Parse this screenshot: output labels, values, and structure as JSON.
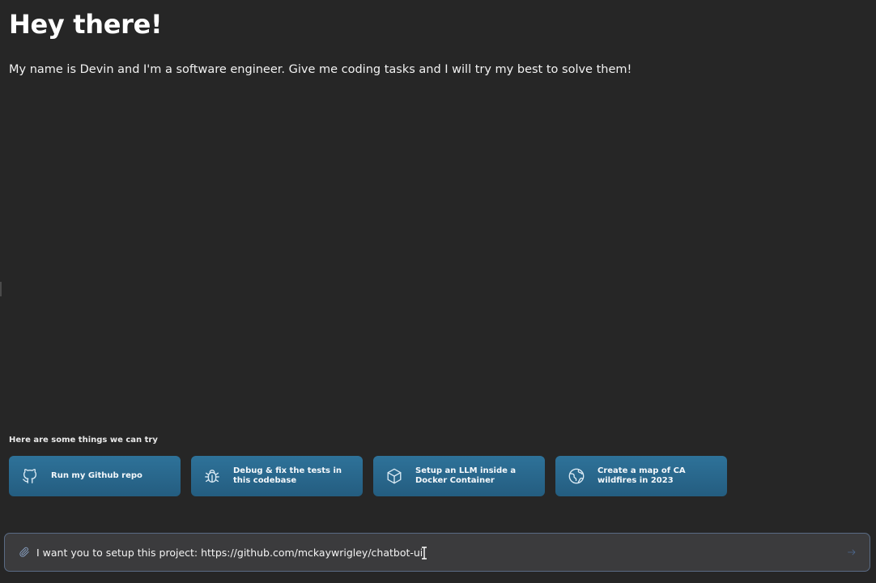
{
  "header": {
    "title": "Hey there!",
    "intro": "My name is Devin and I'm a software engineer. Give me coding tasks and I will try my best to solve them!"
  },
  "suggestions": {
    "label": "Here are some things we can try",
    "items": [
      {
        "label": "Run my Github repo",
        "icon": "github-icon"
      },
      {
        "label": "Debug & fix the tests in this codebase",
        "icon": "bug-icon"
      },
      {
        "label": "Setup an LLM inside a Docker Container",
        "icon": "box-icon"
      },
      {
        "label": "Create a map of CA wildfires in 2023",
        "icon": "globe-icon"
      }
    ]
  },
  "composer": {
    "value": "I want you to setup this project: https://github.com/mckaywrigley/chatbot-ui",
    "attach_icon": "paperclip-icon",
    "send_icon": "arrow-right-icon"
  },
  "colors": {
    "background": "#262626",
    "card": "#2a6890",
    "input_background": "#3b3b3d",
    "input_border": "#5a6b84"
  }
}
